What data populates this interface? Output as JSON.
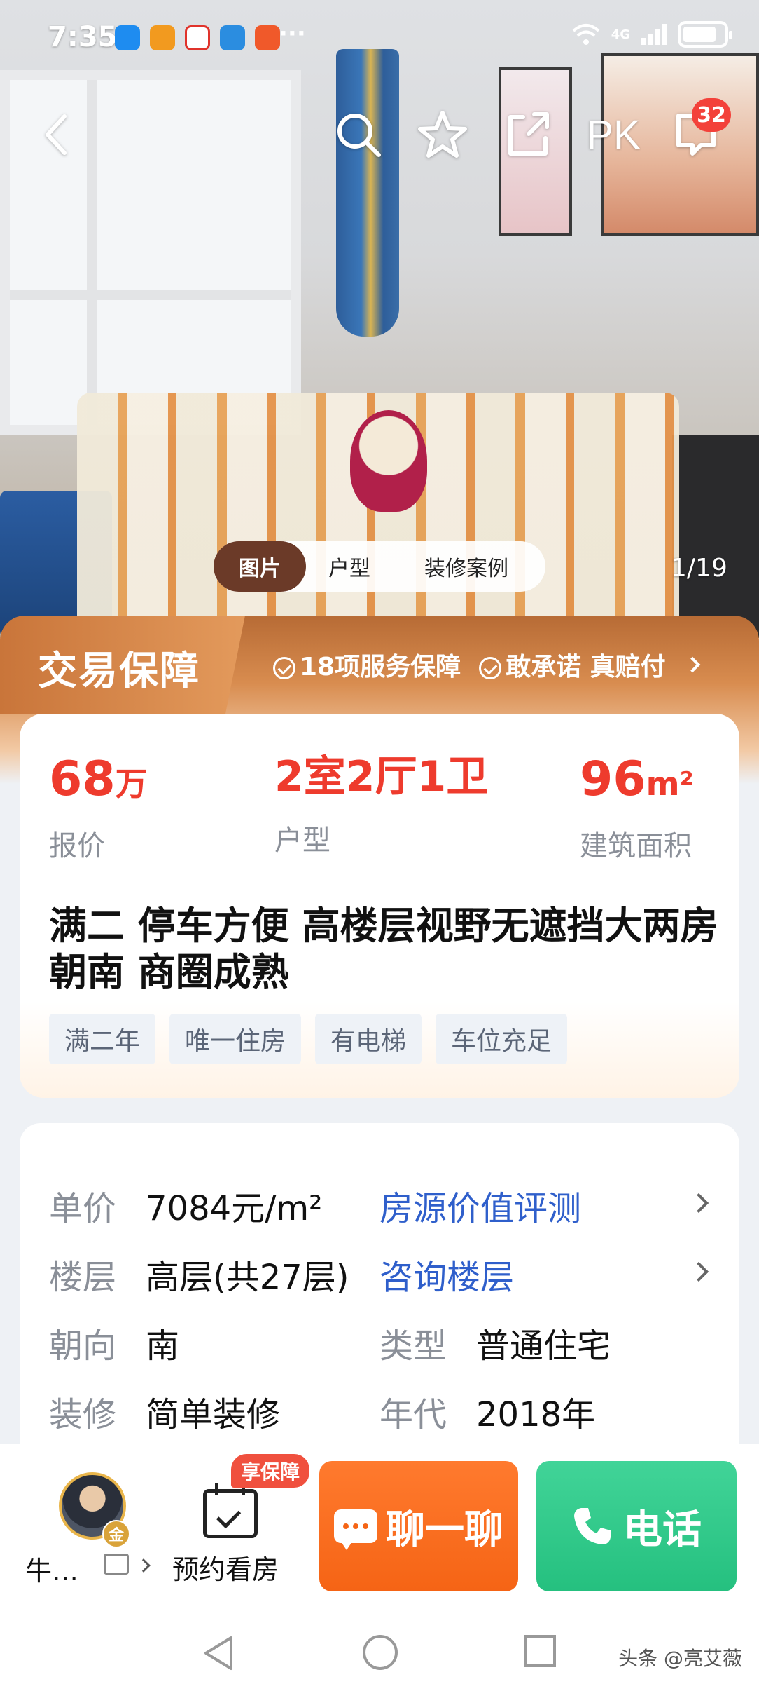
{
  "status_bar": {
    "time": "7:35",
    "network": "4G",
    "notification_icons": [
      "message-icon",
      "play-icon",
      "weibo-icon",
      "browser-icon",
      "app-icon"
    ],
    "more": "···"
  },
  "nav": {
    "compare_label": "PK",
    "message_count": "32"
  },
  "photo": {
    "tabs": [
      "图片",
      "户型",
      "装修案例"
    ],
    "active_tab": "图片",
    "counter": "1/19"
  },
  "guarantee": {
    "title": "交易保障",
    "items": [
      "18项服务保障",
      "敢承诺 真赔付"
    ]
  },
  "summary": {
    "price": {
      "value": "68",
      "unit": "万",
      "label": "报价"
    },
    "layout": {
      "value": "2室2厅1卫",
      "label": "户型"
    },
    "area": {
      "value": "96",
      "unit": "m²",
      "label": "建筑面积"
    },
    "title": "满二   停车方便 高楼层视野无遮挡大两房 朝南 商圈成熟",
    "tags": [
      "满二年",
      "唯一住房",
      "有电梯",
      "车位充足"
    ]
  },
  "details": {
    "unit_price": {
      "label": "单价",
      "value": "7084元/m²",
      "link": "房源价值评测"
    },
    "floor": {
      "label": "楼层",
      "value": "高层(共27层)",
      "link": "咨询楼层"
    },
    "orientation": {
      "label": "朝向",
      "value": "南"
    },
    "type": {
      "label": "类型",
      "value": "普通住宅"
    },
    "decoration": {
      "label": "装修",
      "value": "简单装修"
    },
    "year": {
      "label": "年代",
      "value": "2018年"
    }
  },
  "bottom": {
    "agent_name": "牛…",
    "agent_badge": "金",
    "schedule_label": "预约看房",
    "schedule_badge": "享保障",
    "chat_label": "聊一聊",
    "phone_label": "电话"
  },
  "watermark": "头条 @亮艾薇",
  "colors": {
    "price_red": "#ee3b2d",
    "link_blue": "#2f5fcb",
    "chat_orange": "#f56415",
    "phone_green": "#25c07f",
    "guarantee_brown": "#b76b35"
  }
}
